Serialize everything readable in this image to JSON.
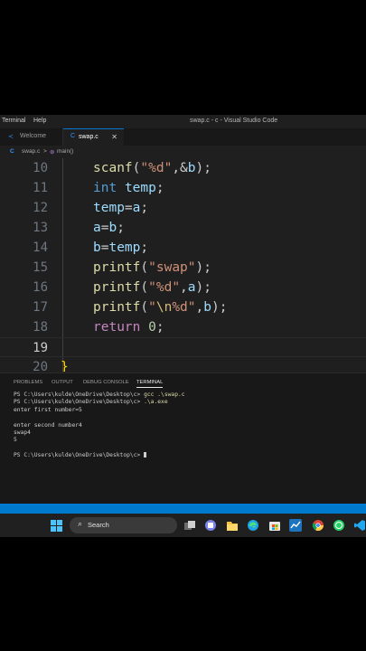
{
  "window": {
    "title": "swap.c - c - Visual Studio Code",
    "menu": [
      "Terminal",
      "Help"
    ]
  },
  "tabs": [
    {
      "icon": "vscode-icon",
      "label": "Welcome"
    },
    {
      "icon": "c-icon",
      "label": "swap.c",
      "close": "✕",
      "active": true
    }
  ],
  "breadcrumb": {
    "file": "swap.c",
    "separator": ">",
    "symbol": "main()"
  },
  "editor": {
    "line_numbers": [
      "10",
      "11",
      "12",
      "13",
      "14",
      "15",
      "16",
      "17",
      "18",
      "19",
      "20"
    ],
    "active_line": "19"
  },
  "panel": {
    "tabs": [
      "PROBLEMS",
      "OUTPUT",
      "DEBUG CONSOLE",
      "TERMINAL"
    ],
    "active_tab": "TERMINAL",
    "terminal": {
      "prompt": "PS C:\\Users\\kulde\\OneDrive\\Desktop\\c>",
      "cmd1": "gcc .\\swap.c",
      "cmd2": ".\\a.exe",
      "out1": "enter first number=5",
      "out2": "enter second number4",
      "out3": "swap4",
      "out4": "5"
    }
  },
  "taskbar": {
    "search_label": "Search",
    "icons": [
      "task-view-icon",
      "teams-icon",
      "file-explorer-icon",
      "edge-icon",
      "store-icon",
      "stock-widget-icon",
      "chrome-icon",
      "whatsapp-icon",
      "vscode-icon"
    ]
  },
  "colors": {
    "accent": "#0078d4",
    "statusbar": "#007acc",
    "editor_bg": "#1f1f1f"
  }
}
